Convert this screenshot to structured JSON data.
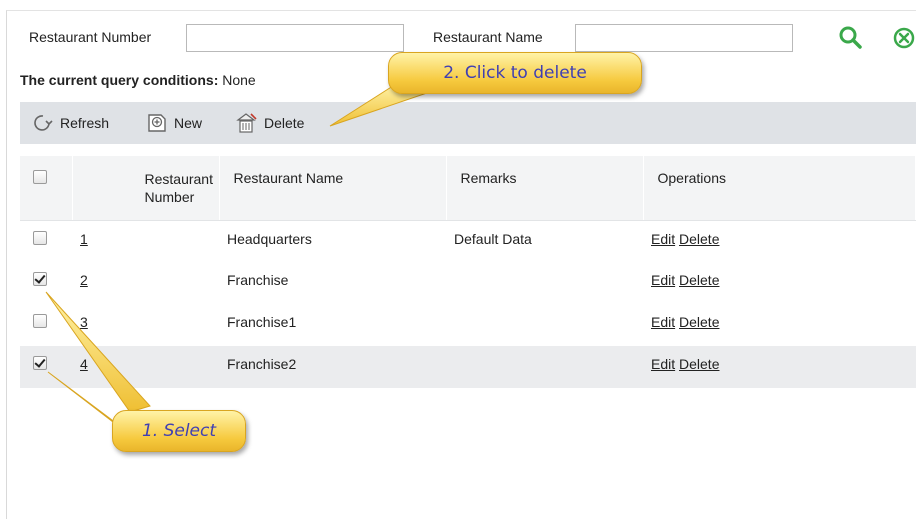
{
  "filters": {
    "restaurant_number_label": "Restaurant Number",
    "restaurant_number_value": "",
    "restaurant_name_label": "Restaurant Name",
    "restaurant_name_value": ""
  },
  "query": {
    "label": "The current query conditions:",
    "value": "None"
  },
  "toolbar": {
    "refresh_label": "Refresh",
    "new_label": "New",
    "delete_label": "Delete"
  },
  "table": {
    "headers": {
      "number": "Restaurant\nNumber",
      "name": "Restaurant Name",
      "remarks": "Remarks",
      "operations": "Operations"
    },
    "rows": [
      {
        "number": "1",
        "name": "Headquarters",
        "remarks": "Default Data",
        "edit": "Edit",
        "delete": "Delete",
        "checked": false
      },
      {
        "number": "2",
        "name": "Franchise",
        "remarks": "",
        "edit": "Edit",
        "delete": "Delete",
        "checked": true
      },
      {
        "number": "3",
        "name": "Franchise1",
        "remarks": "",
        "edit": "Edit",
        "delete": "Delete",
        "checked": false
      },
      {
        "number": "4",
        "name": "Franchise2",
        "remarks": "",
        "edit": "Edit",
        "delete": "Delete",
        "checked": true
      }
    ]
  },
  "annotations": {
    "select": "1. Select",
    "delete": "2. Click to delete"
  },
  "icons": {
    "search": "search-icon",
    "clear": "clear-icon",
    "refresh": "refresh-icon",
    "new": "new-icon",
    "delete": "delete-icon"
  },
  "colors": {
    "accent_green": "#3aa84a",
    "toolbar_bg": "#dfe2e6",
    "callout_text": "#3f3fb3"
  }
}
